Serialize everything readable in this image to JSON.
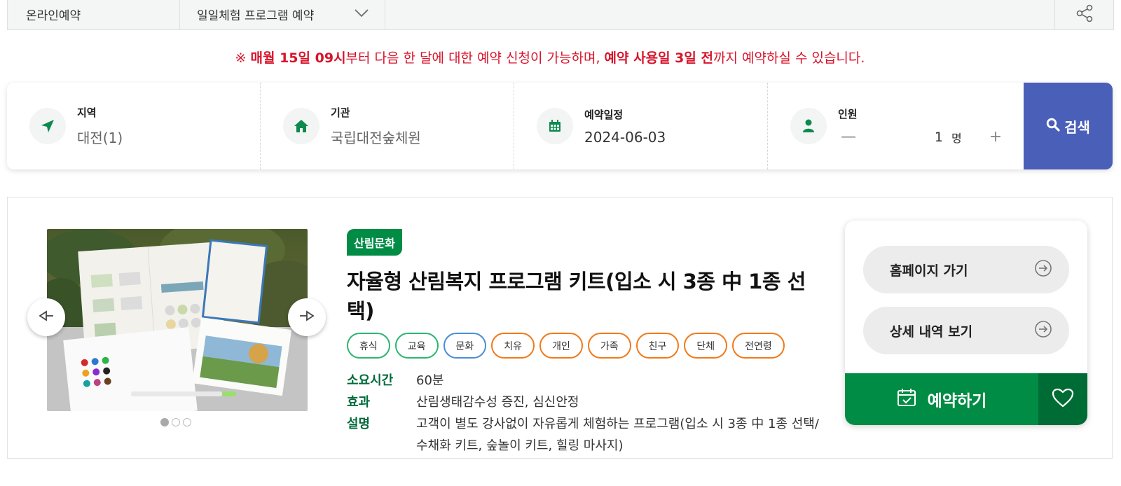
{
  "breadcrumb": {
    "home": "온라인예약",
    "selected": "일일체험 프로그램 예약"
  },
  "notice": {
    "prefix": "※ ",
    "bold1": "매월 15일 09시",
    "mid1": "부터 다음 한 달에 대한 예약 신청이 가능하며, ",
    "bold2": "예약 사용일 3일 전",
    "mid2": "까지 예약하실 수 있습니다."
  },
  "search": {
    "region_label": "지역",
    "region_value": "대전(1)",
    "org_label": "기관",
    "org_value": "국립대전숲체원",
    "date_label": "예약일정",
    "date_value": "2024-06-03",
    "people_label": "인원",
    "people_minus": "—",
    "people_count": "1",
    "people_unit": "명",
    "people_plus": "+",
    "search_label": "검색"
  },
  "program": {
    "category": "산림문화",
    "title": "자율형 산림복지 프로그램 키트(입소 시 3종 中 1종 선택)",
    "tags": [
      {
        "label": "휴식",
        "color": "green"
      },
      {
        "label": "교육",
        "color": "green"
      },
      {
        "label": "문화",
        "color": "blue"
      },
      {
        "label": "치유",
        "color": "orange"
      },
      {
        "label": "개인",
        "color": "orange"
      },
      {
        "label": "가족",
        "color": "orange"
      },
      {
        "label": "친구",
        "color": "orange"
      },
      {
        "label": "단체",
        "color": "orange"
      },
      {
        "label": "전연령",
        "color": "orange"
      }
    ],
    "specs": [
      {
        "key": "소요시간",
        "value": "60분"
      },
      {
        "key": "효과",
        "value": "산림생태감수성 증진, 심신안정"
      },
      {
        "key": "설명",
        "value": "고객이 별도 강사없이 자유롭게 체험하는 프로그램(입소 시 3종 中 1종 선택/수채화 키트, 숲놀이 키트, 힐링 마사지)"
      }
    ],
    "gallery_dots": 3,
    "gallery_active": 1
  },
  "actions": {
    "homepage": "홈페이지 가기",
    "detail": "상세 내역 보기",
    "reserve": "예약하기"
  },
  "colors": {
    "primary_green": "#008c45",
    "dark_green": "#006c35",
    "search_blue": "#4a5fb8",
    "notice_red": "#d7142b"
  }
}
